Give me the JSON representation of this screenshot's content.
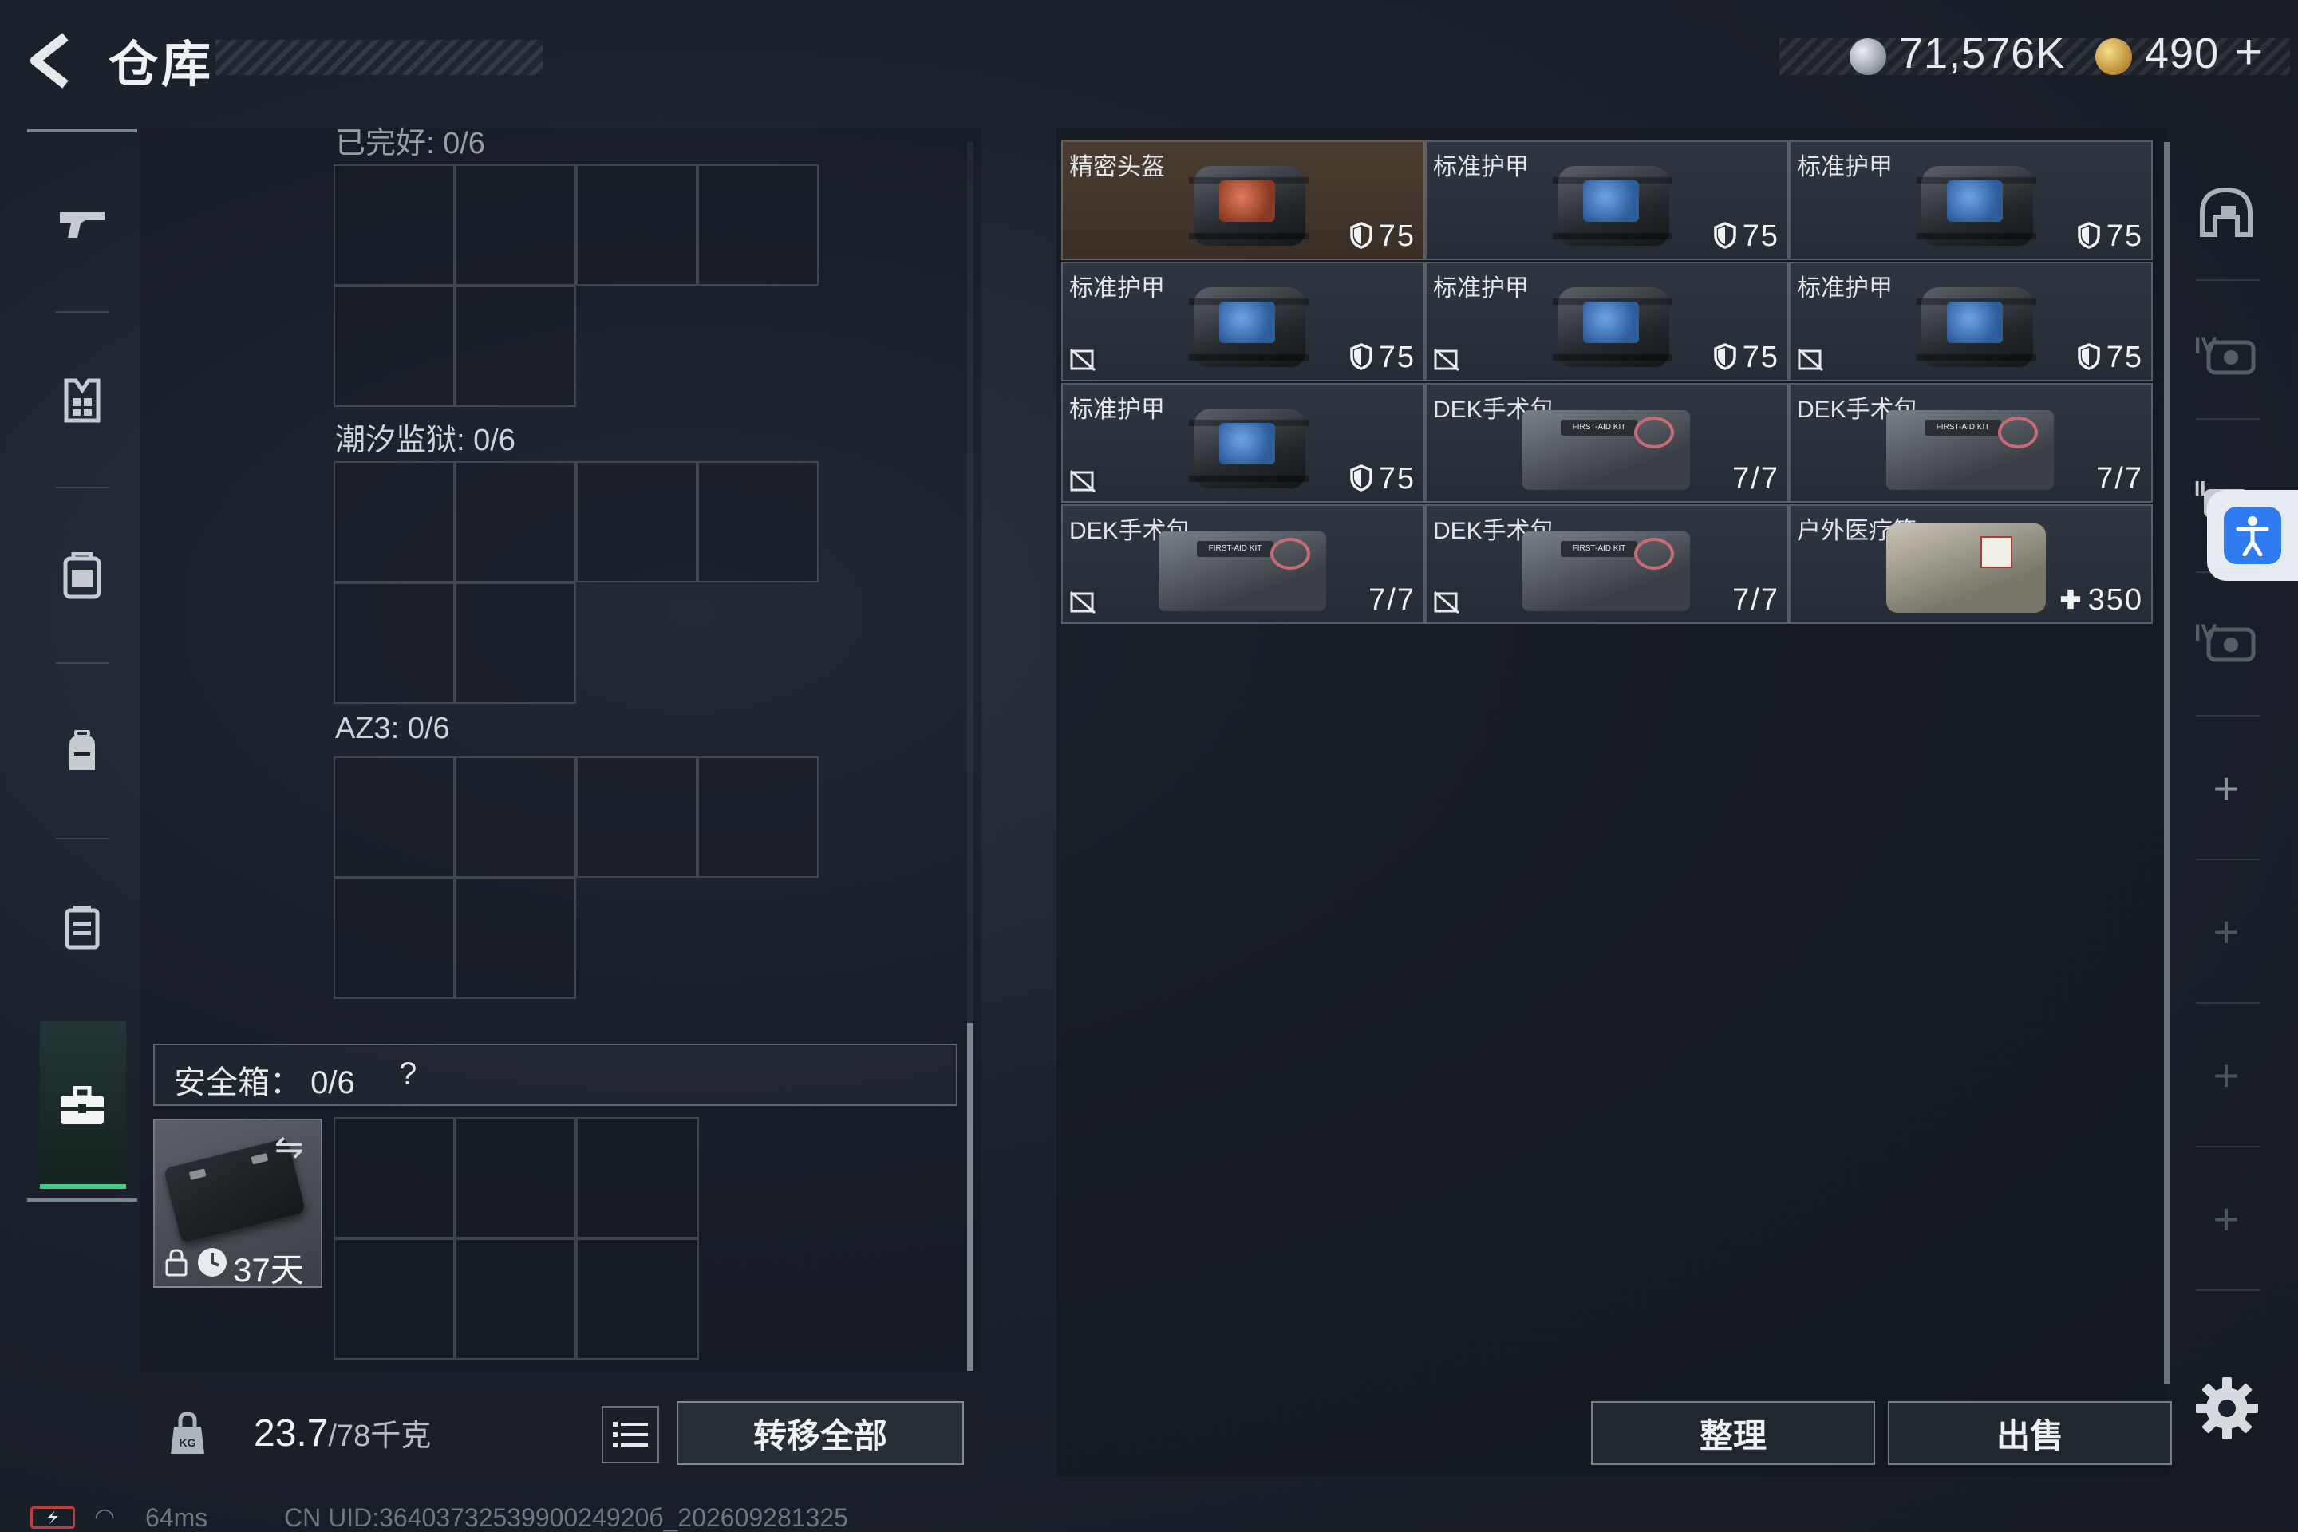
{
  "header": {
    "title": "仓库",
    "currency_silver": "71,576K",
    "currency_gold": "490",
    "plus_label": "+"
  },
  "nav": {
    "items": [
      "weapons",
      "armor",
      "chest-rig",
      "backpack",
      "container",
      "safe-box"
    ],
    "active": "safe-box"
  },
  "containers": {
    "top_partial_label": "已完好: 0/6",
    "sections": [
      {
        "label": "潮汐监狱: 0/6"
      },
      {
        "label": "AZ3: 0/6"
      }
    ],
    "safe_box": {
      "label": "安全箱",
      "count": "0/6",
      "help": "?",
      "duration": "37天"
    }
  },
  "footer_left": {
    "weight_current": "23.7",
    "weight_max": "/78千克",
    "transfer_all": "转移全部"
  },
  "inventory": {
    "items": [
      {
        "name": "精密头盔",
        "value": "75",
        "kind": "armor",
        "pad": "red",
        "highlight": true,
        "flag": false,
        "icon": "shield-icon"
      },
      {
        "name": "标准护甲",
        "value": "75",
        "kind": "armor",
        "pad": "blue",
        "highlight": false,
        "flag": false,
        "icon": "shield-icon"
      },
      {
        "name": "标准护甲",
        "value": "75",
        "kind": "armor",
        "pad": "blue",
        "highlight": false,
        "flag": false,
        "icon": "shield-icon"
      },
      {
        "name": "标准护甲",
        "value": "75",
        "kind": "armor",
        "pad": "blue",
        "highlight": false,
        "flag": true,
        "icon": "shield-icon"
      },
      {
        "name": "标准护甲",
        "value": "75",
        "kind": "armor",
        "pad": "blue",
        "highlight": false,
        "flag": true,
        "icon": "shield-icon"
      },
      {
        "name": "标准护甲",
        "value": "75",
        "kind": "armor",
        "pad": "blue",
        "highlight": false,
        "flag": true,
        "icon": "shield-icon"
      },
      {
        "name": "标准护甲",
        "value": "75",
        "kind": "armor",
        "pad": "blue",
        "highlight": false,
        "flag": true,
        "icon": "shield-icon"
      },
      {
        "name": "DEK手术包",
        "value": "7/7",
        "kind": "kit",
        "highlight": false,
        "flag": false
      },
      {
        "name": "DEK手术包",
        "value": "7/7",
        "kind": "kit",
        "highlight": false,
        "flag": false
      },
      {
        "name": "DEK手术包",
        "value": "7/7",
        "kind": "kit",
        "highlight": false,
        "flag": true
      },
      {
        "name": "DEK手术包",
        "value": "7/7",
        "kind": "kit",
        "highlight": false,
        "flag": true
      },
      {
        "name": "户外医疗箱",
        "value": "350",
        "kind": "bag",
        "highlight": false,
        "flag": false,
        "icon": "plus-icon"
      }
    ],
    "kit_label": "FIRST-AID KIT"
  },
  "actions": {
    "sort": "整理",
    "sell": "出售"
  },
  "status": {
    "ping": "64ms",
    "uid": "CN UID:3640373253990024920б_202609281325"
  },
  "colors": {
    "accent_green": "#3fcf86",
    "highlight_slot": "#4a3c30",
    "battery_red": "#c23a3a",
    "accessibility_blue": "#2f7cf0"
  }
}
